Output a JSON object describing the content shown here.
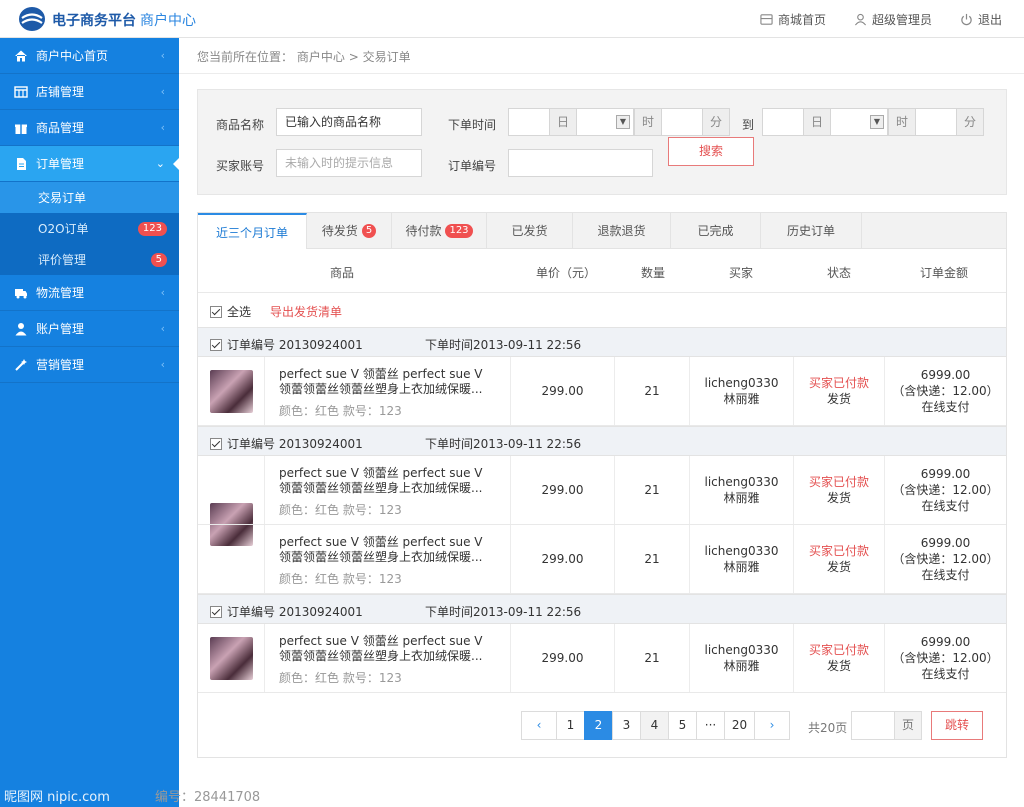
{
  "header": {
    "brand": "电子商务平台",
    "brand_sub": "商户中心",
    "links": [
      {
        "label": "商城首页",
        "icon": "store-icon"
      },
      {
        "label": "超级管理员",
        "icon": "user-icon"
      },
      {
        "label": "退出",
        "icon": "power-icon"
      }
    ]
  },
  "sidebar": {
    "items": [
      {
        "label": "商户中心首页",
        "icon": "home-icon"
      },
      {
        "label": "店铺管理",
        "icon": "table-icon"
      },
      {
        "label": "商品管理",
        "icon": "gift-icon"
      },
      {
        "label": "订单管理",
        "icon": "document-icon"
      },
      {
        "label": "物流管理",
        "icon": "truck-icon"
      },
      {
        "label": "账户管理",
        "icon": "user-icon"
      },
      {
        "label": "营销管理",
        "icon": "magic-icon"
      }
    ],
    "sub_items": [
      {
        "label": "交易订单",
        "badge": ""
      },
      {
        "label": "O2O订单",
        "badge": "123"
      },
      {
        "label": "评价管理",
        "badge": "5"
      }
    ]
  },
  "breadcrumb": {
    "prefix": "您当前所在位置：",
    "level1": "商户中心",
    "sep": ">",
    "level2": "交易订单"
  },
  "filter": {
    "product_label": "商品名称",
    "product_value": "已输入的商品名称",
    "buyer_label": "买家账号",
    "buyer_placeholder": "未输入时的提示信息",
    "time_label": "下单时间",
    "day": "日",
    "hour": "时",
    "minute": "分",
    "to": "到",
    "order_no_label": "订单编号",
    "search_button": "搜索"
  },
  "tabs": [
    {
      "label": "近三个月订单",
      "badge": ""
    },
    {
      "label": "待发货",
      "badge": "5"
    },
    {
      "label": "待付款",
      "badge": "123"
    },
    {
      "label": "已发货",
      "badge": ""
    },
    {
      "label": "退款退货",
      "badge": ""
    },
    {
      "label": "已完成",
      "badge": ""
    },
    {
      "label": "历史订单",
      "badge": ""
    }
  ],
  "columns": [
    "商品",
    "单价（元）",
    "数量",
    "买家",
    "状态",
    "订单金额"
  ],
  "select_all": "全选",
  "export": "导出发货清单",
  "orders": [
    {
      "order_no": "订单编号 20130924001",
      "time": "下单时间2013-09-11  22:56",
      "items": [
        {
          "name": "perfect sue  V  领蕾丝 perfect sue  V 领蕾领蕾丝领蕾丝塑身上衣加绒保暖...",
          "attr": "颜色：红色   款号：123",
          "price": "299.00",
          "qty": "21",
          "buyer_id": "licheng0330",
          "buyer_name": "林丽雅",
          "status": "买家已付款",
          "action": "发货",
          "amount": "6999.00",
          "shipping": "（含快递：12.00）",
          "pay": "在线支付"
        }
      ]
    },
    {
      "order_no": "订单编号 20130924001",
      "time": "下单时间2013-09-11  22:56",
      "items": [
        {
          "name": "perfect sue  V  领蕾丝 perfect sue  V 领蕾领蕾丝领蕾丝塑身上衣加绒保暖...",
          "attr": "颜色：红色   款号：123",
          "price": "299.00",
          "qty": "21",
          "buyer_id": "licheng0330",
          "buyer_name": "林丽雅",
          "status": "买家已付款",
          "action": "发货",
          "amount": "6999.00",
          "shipping": "（含快递：12.00）",
          "pay": "在线支付"
        },
        {
          "name": "perfect sue  V  领蕾丝 perfect sue  V 领蕾领蕾丝领蕾丝塑身上衣加绒保暖...",
          "attr": "颜色：红色   款号：123",
          "price": "299.00",
          "qty": "21",
          "buyer_id": "licheng0330",
          "buyer_name": "林丽雅",
          "status": "买家已付款",
          "action": "发货",
          "amount": "6999.00",
          "shipping": "（含快递：12.00）",
          "pay": "在线支付"
        }
      ]
    },
    {
      "order_no": "订单编号 20130924001",
      "time": "下单时间2013-09-11  22:56",
      "items": [
        {
          "name": "perfect sue  V  领蕾丝 perfect sue  V 领蕾领蕾丝领蕾丝塑身上衣加绒保暖...",
          "attr": "颜色：红色   款号：123",
          "price": "299.00",
          "qty": "21",
          "buyer_id": "licheng0330",
          "buyer_name": "林丽雅",
          "status": "买家已付款",
          "action": "发货",
          "amount": "6999.00",
          "shipping": "（含快递：12.00）",
          "pay": "在线支付"
        }
      ]
    }
  ],
  "pager": {
    "prev": "‹",
    "pages": [
      "1",
      "2",
      "3",
      "4",
      "5",
      "···",
      "20"
    ],
    "current": "2",
    "next": "›",
    "total": "共20页",
    "unit": "页",
    "jump": "跳转"
  },
  "watermark": {
    "left": "昵图网 nipic.com",
    "right": "编号：28441708"
  },
  "colors": {
    "sidebar": "#1581e0",
    "accent": "#2b8be4",
    "alert": "#e45050"
  }
}
